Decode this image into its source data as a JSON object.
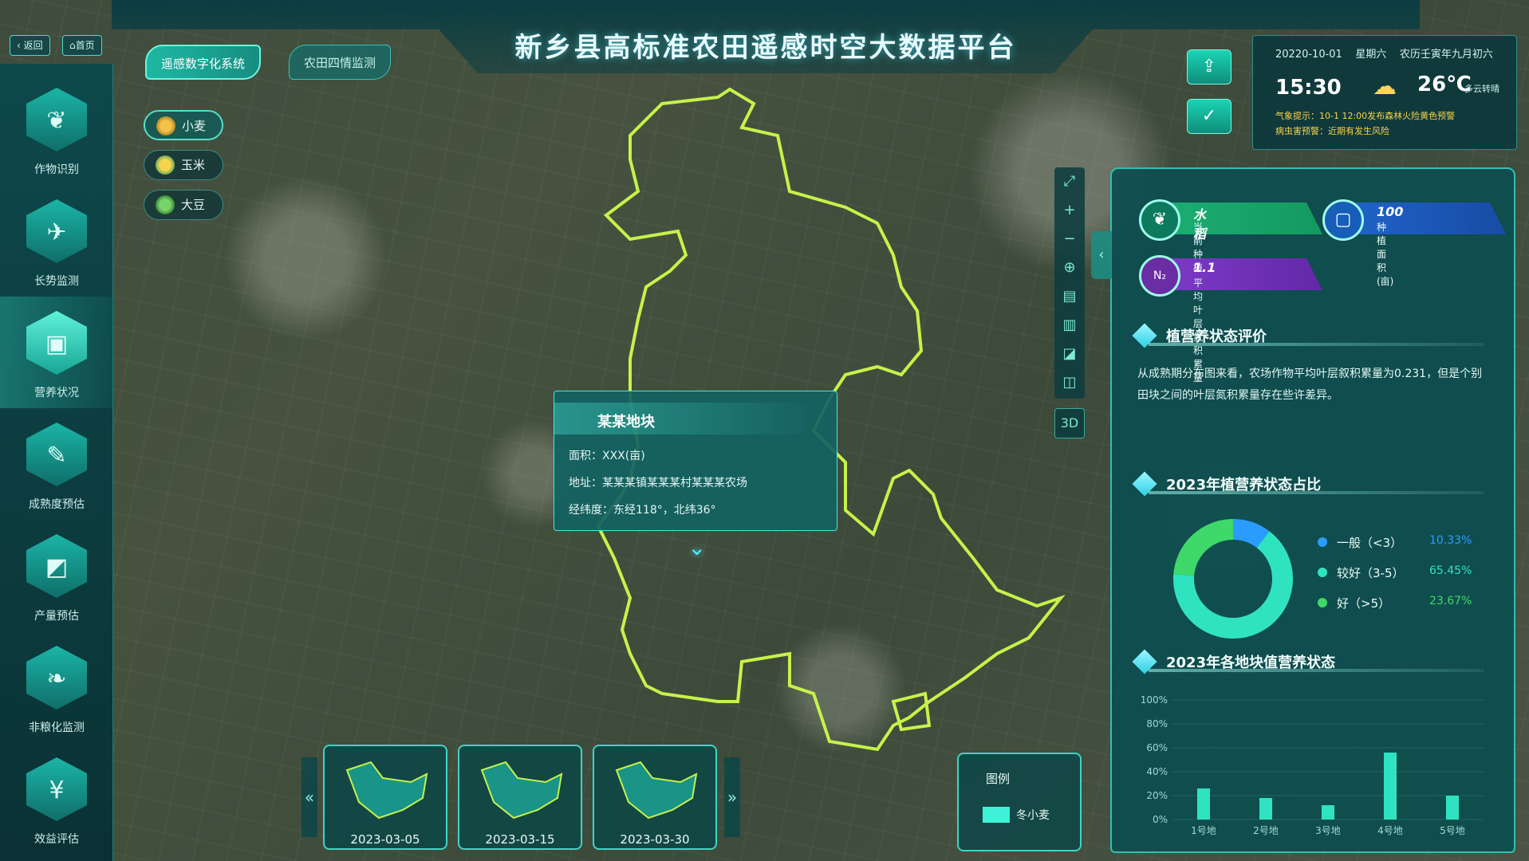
{
  "header": {
    "title": "新乡县高标准农田遥感时空大数据平台"
  },
  "nav_top": {
    "back": "返回",
    "home": "首页"
  },
  "tabs": [
    {
      "label": "遥感数字化系统"
    },
    {
      "label": "农田四情监测"
    }
  ],
  "crops": [
    {
      "label": "小麦"
    },
    {
      "label": "玉米"
    },
    {
      "label": "大豆"
    }
  ],
  "sidebar": {
    "items": [
      {
        "label": "作物识别",
        "icon": "sprout-icon"
      },
      {
        "label": "长势监测",
        "icon": "satellite-icon"
      },
      {
        "label": "营养状况",
        "icon": "nutrition-icon"
      },
      {
        "label": "成熟度预估",
        "icon": "tag-icon"
      },
      {
        "label": "产量预估",
        "icon": "chart-icon"
      },
      {
        "label": "非粮化监测",
        "icon": "leaf-icon"
      },
      {
        "label": "效益评估",
        "icon": "money-bag-icon"
      }
    ]
  },
  "weather": {
    "date": "20220-10-01",
    "weekday": "星期六",
    "lunar": "农历壬寅年九月初六",
    "time": "15:30",
    "temp": "26℃",
    "cond": "多云转晴",
    "tip1": "气象提示：10-1 12:00发布森林火险黄色预警",
    "tip2": "病虫害预警：近期有发生风险"
  },
  "tools": {
    "three_d": "3D"
  },
  "popup": {
    "title": "某某地块",
    "area": "面积：XXX(亩)",
    "addr": "地址：某某某镇某某某村某某某农场",
    "geo": "经纬度：东经118°，北纬36°"
  },
  "thumbs": [
    {
      "date": "2023-03-05"
    },
    {
      "date": "2023-03-15"
    },
    {
      "date": "2023-03-30"
    }
  ],
  "legend": {
    "title": "图例",
    "item": "冬小麦",
    "color": "#3ef2d8"
  },
  "stats": {
    "rice": {
      "value": "水稻",
      "label": "当前种植"
    },
    "area": {
      "value": "100",
      "label": "种植面积(亩)"
    },
    "nitrogen": {
      "value": "1.1",
      "label": "平均叶层氮积累量",
      "badge": "N₂"
    }
  },
  "sections": {
    "eval": "植营养状态评价",
    "share": "2023年植营养状态占比",
    "plots": "2023年各地块值营养状态"
  },
  "eval_text": "从成熟期分布图来看，农场作物平均叶层叙积累量为0.231，但是个别田块之间的叶层氮积累量存在些许差异。",
  "chart_data": [
    {
      "type": "pie",
      "title": "",
      "series": [
        {
          "name": "一般（<3）",
          "value": 10.33,
          "label": "10.33%",
          "color": "#2b9cff"
        },
        {
          "name": "较好（3-5）",
          "value": 65.45,
          "label": "65.45%",
          "color": "#2fe3c1"
        },
        {
          "name": "好（>5）",
          "value": 23.67,
          "label": "23.67%",
          "color": "#3fd86a"
        }
      ]
    },
    {
      "type": "bar",
      "title": "",
      "categories": [
        "1号地",
        "2号地",
        "3号地",
        "4号地",
        "5号地"
      ],
      "values": [
        26,
        18,
        12,
        56,
        20
      ],
      "yticks": [
        "0%",
        "20%",
        "40%",
        "60%",
        "80%",
        "100%"
      ],
      "ylim": [
        0,
        100
      ],
      "grid": true
    }
  ]
}
